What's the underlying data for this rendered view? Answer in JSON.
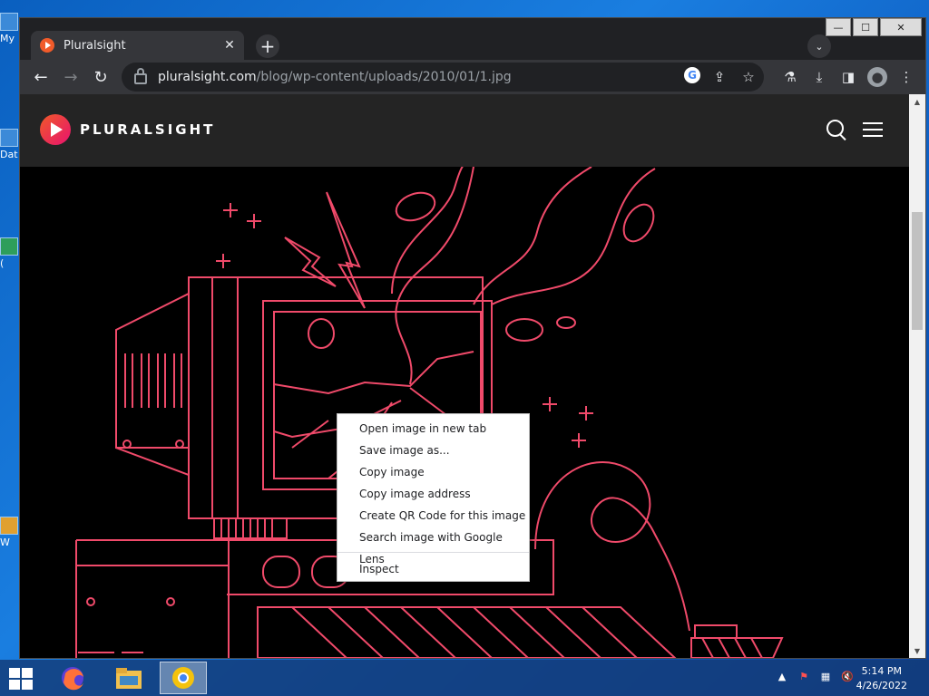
{
  "desktop": {
    "icons": [
      {
        "label": "My"
      },
      {
        "label": "Dat"
      },
      {
        "label": "("
      },
      {
        "label": "W"
      }
    ]
  },
  "browser": {
    "window_controls": {
      "minimize": "—",
      "maximize": "☐",
      "close": "✕"
    },
    "tab": {
      "title": "Pluralsight",
      "close": "✕"
    },
    "new_tab": "+",
    "tab_search": "⌄",
    "nav": {
      "back": "←",
      "forward": "→",
      "reload": "↻"
    },
    "url_host": "pluralsight.com",
    "url_path": "/blog/wp-content/uploads/2010/01/1.jpg",
    "omnibox_icons": [
      "google-lens",
      "share",
      "star"
    ],
    "toolbar_icons": [
      "labs",
      "download",
      "side-panel",
      "profile",
      "menu"
    ],
    "site": {
      "brand": "PLURALSIGHT"
    },
    "accent_colors": {
      "brand_orange": "#f05a28",
      "brand_pink": "#e8126f",
      "art_stroke": "#f04a6a"
    }
  },
  "context_menu": {
    "items": [
      "Open image in new tab",
      "Save image as...",
      "Copy image",
      "Copy image address",
      "Create QR Code for this image",
      "Search image with Google Lens"
    ],
    "inspect": "Inspect"
  },
  "taskbar": {
    "apps": [
      "firefox",
      "file-explorer",
      "chrome"
    ],
    "tray_icons": [
      "show-hidden",
      "flag",
      "network",
      "volume"
    ],
    "time": "5:14 PM",
    "date": "4/26/2022"
  }
}
